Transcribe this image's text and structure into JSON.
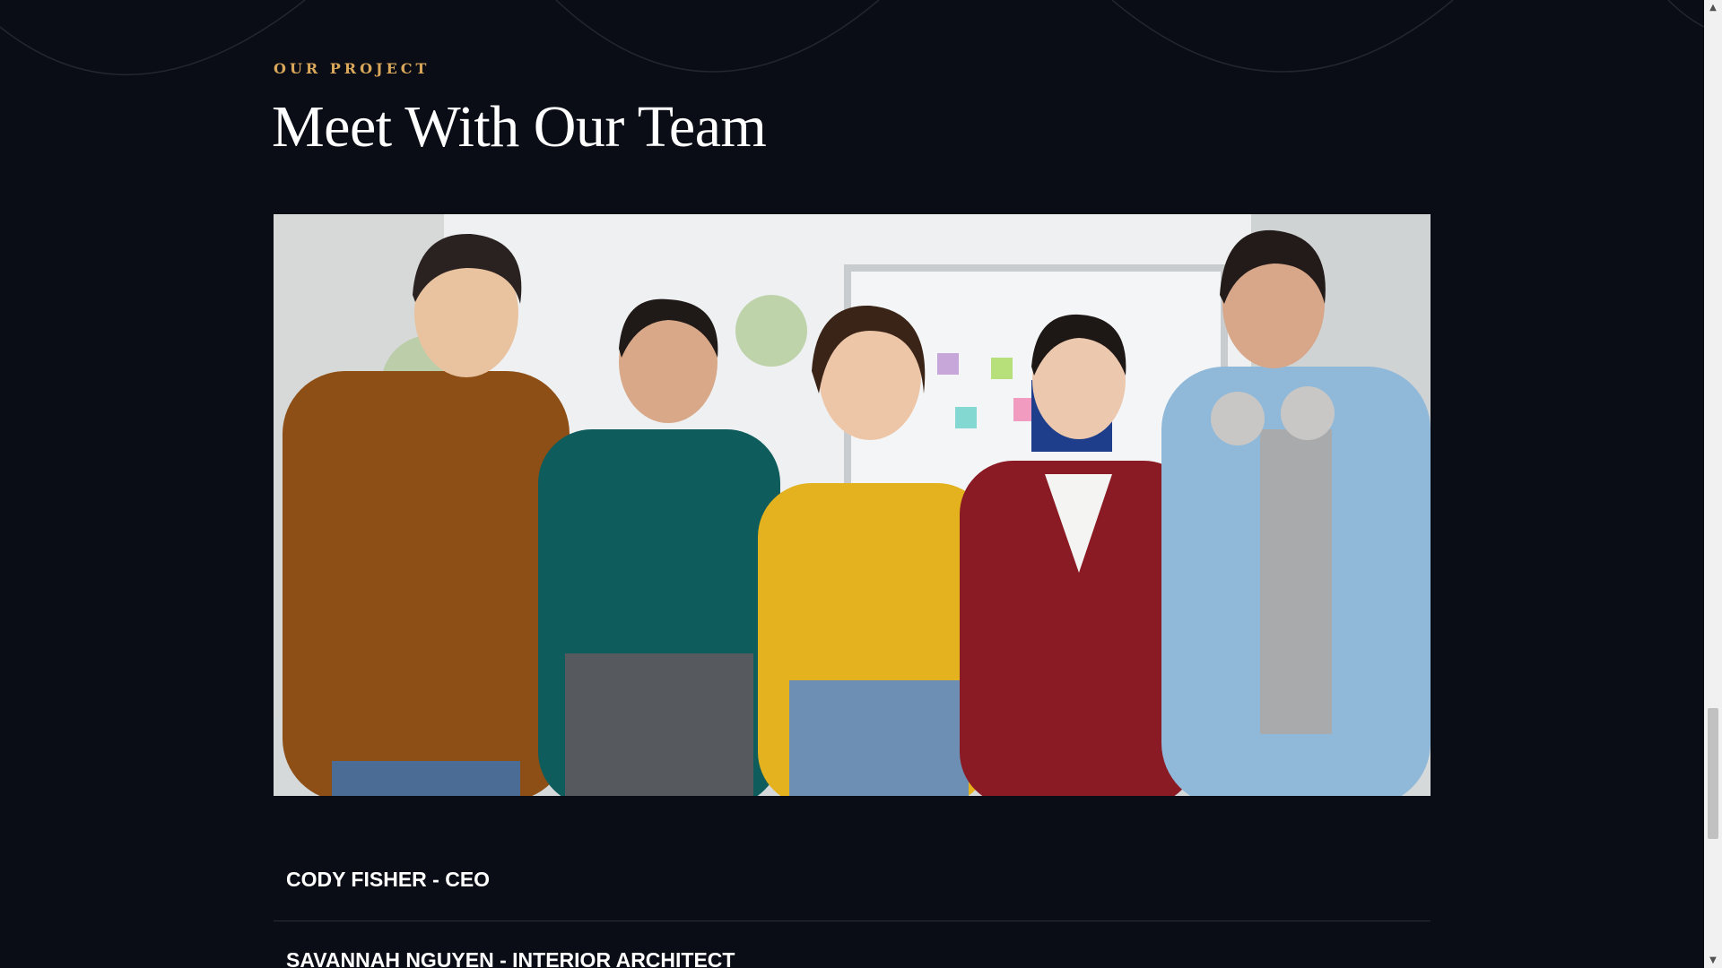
{
  "section": {
    "eyebrow": "OUR PROJECT",
    "title": "Meet With Our Team"
  },
  "team": [
    {
      "label": "CODY FISHER - CEO"
    },
    {
      "label": "SAVANNAH NGUYEN - INTERIOR ARCHITECT"
    }
  ],
  "colors": {
    "background": "#0b0d16",
    "accent": "#d9a85a",
    "text": "#ffffff",
    "divider": "#2b2e39"
  },
  "icons": {
    "scroll_up": "scroll-up-arrow-icon",
    "scroll_down": "scroll-down-arrow-icon"
  }
}
